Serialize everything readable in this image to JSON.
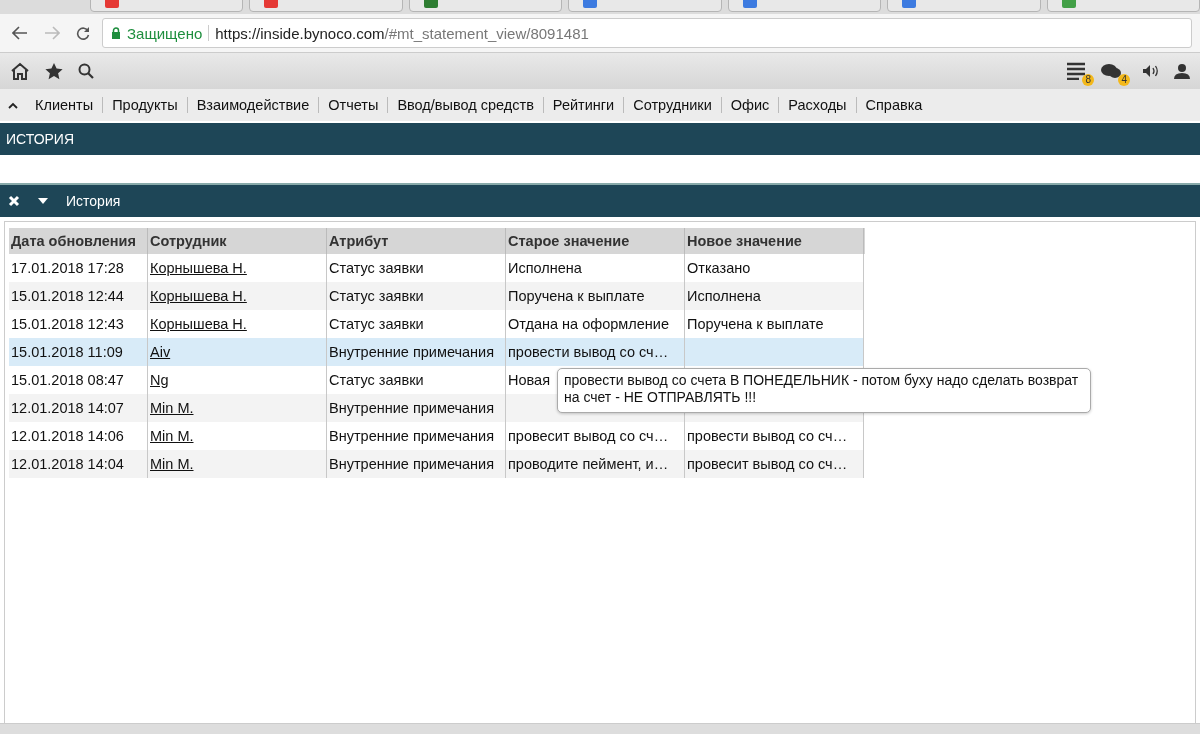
{
  "browser": {
    "tabs": [
      {
        "color": "#e53935"
      },
      {
        "color": "#e53935"
      },
      {
        "color": "#2e7d32"
      },
      {
        "color": "#3d7be0"
      },
      {
        "color": "#3d7be0"
      },
      {
        "color": "#3d7be0"
      },
      {
        "color": "#43a047"
      }
    ],
    "secure_label": "Защищено",
    "url_host": "https://inside.bynoco.com",
    "url_path": "/#mt_statement_view/8091481"
  },
  "toolbar": {
    "badges": [
      {
        "kind": "list",
        "count": "8"
      },
      {
        "kind": "chat",
        "count": "4"
      }
    ]
  },
  "menu": {
    "items": [
      "Клиенты",
      "Продукты",
      "Взаимодействие",
      "Отчеты",
      "Ввод/вывод средств",
      "Рейтинги",
      "Сотрудники",
      "Офис",
      "Расходы",
      "Справка"
    ]
  },
  "page_title": "ИСТОРИЯ",
  "panel": {
    "title": "История",
    "expanded": true
  },
  "table": {
    "columns": [
      "Дата обновления",
      "Сотрудник",
      "Атрибут",
      "Старое значение",
      "Новое значение"
    ],
    "rows": [
      {
        "date": "17.01.2018 17:28",
        "employee": "Корнышева Н.",
        "attribute": "Статус заявки",
        "old": "Исполнена",
        "new": "Отказано",
        "selected": false
      },
      {
        "date": "15.01.2018 12:44",
        "employee": "Корнышева Н.",
        "attribute": "Статус заявки",
        "old": "Поручена к выплате",
        "new": "Исполнена",
        "selected": false
      },
      {
        "date": "15.01.2018 12:43",
        "employee": "Корнышева Н.",
        "attribute": "Статус заявки",
        "old": "Отдана на оформление",
        "new": "Поручена к выплате",
        "selected": false
      },
      {
        "date": "15.01.2018 11:09",
        "employee": "Aiv",
        "attribute": "Внутренние примечания",
        "old": "провести вывод со сч…",
        "new": "",
        "selected": true
      },
      {
        "date": "15.01.2018 08:47",
        "employee": "Ng",
        "attribute": "Статус заявки",
        "old": "Новая",
        "new": "",
        "selected": false
      },
      {
        "date": "12.01.2018 14:07",
        "employee": "Min M.",
        "attribute": "Внутренние примечания",
        "old": "",
        "new": "",
        "selected": false
      },
      {
        "date": "12.01.2018 14:06",
        "employee": "Min M.",
        "attribute": "Внутренние примечания",
        "old": "провесит вывод со сч…",
        "new": "провести вывод со сч…",
        "selected": false
      },
      {
        "date": "12.01.2018 14:04",
        "employee": "Min M.",
        "attribute": "Внутренние примечания",
        "old": "проводите пеймент, и…",
        "new": "провесит вывод со сч…",
        "selected": false
      }
    ]
  },
  "tooltip": "провести вывод со счета В ПОНЕДЕЛЬНИК - потом буху надо сделать возврат на счет - НЕ ОТПРАВЛЯТЬ !!!"
}
